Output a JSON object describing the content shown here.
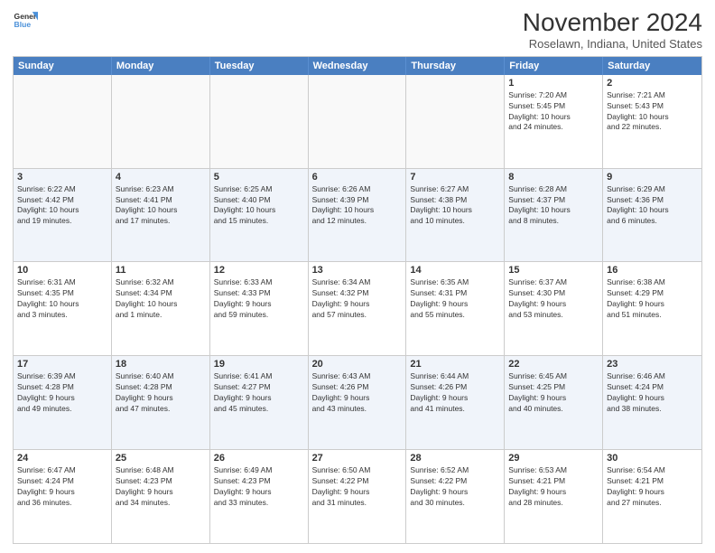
{
  "logo": {
    "line1": "General",
    "line2": "Blue"
  },
  "title": "November 2024",
  "subtitle": "Roselawn, Indiana, United States",
  "days_of_week": [
    "Sunday",
    "Monday",
    "Tuesday",
    "Wednesday",
    "Thursday",
    "Friday",
    "Saturday"
  ],
  "weeks": [
    [
      {
        "day": "",
        "info": ""
      },
      {
        "day": "",
        "info": ""
      },
      {
        "day": "",
        "info": ""
      },
      {
        "day": "",
        "info": ""
      },
      {
        "day": "",
        "info": ""
      },
      {
        "day": "1",
        "info": "Sunrise: 7:20 AM\nSunset: 5:45 PM\nDaylight: 10 hours\nand 24 minutes."
      },
      {
        "day": "2",
        "info": "Sunrise: 7:21 AM\nSunset: 5:43 PM\nDaylight: 10 hours\nand 22 minutes."
      }
    ],
    [
      {
        "day": "3",
        "info": "Sunrise: 6:22 AM\nSunset: 4:42 PM\nDaylight: 10 hours\nand 19 minutes."
      },
      {
        "day": "4",
        "info": "Sunrise: 6:23 AM\nSunset: 4:41 PM\nDaylight: 10 hours\nand 17 minutes."
      },
      {
        "day": "5",
        "info": "Sunrise: 6:25 AM\nSunset: 4:40 PM\nDaylight: 10 hours\nand 15 minutes."
      },
      {
        "day": "6",
        "info": "Sunrise: 6:26 AM\nSunset: 4:39 PM\nDaylight: 10 hours\nand 12 minutes."
      },
      {
        "day": "7",
        "info": "Sunrise: 6:27 AM\nSunset: 4:38 PM\nDaylight: 10 hours\nand 10 minutes."
      },
      {
        "day": "8",
        "info": "Sunrise: 6:28 AM\nSunset: 4:37 PM\nDaylight: 10 hours\nand 8 minutes."
      },
      {
        "day": "9",
        "info": "Sunrise: 6:29 AM\nSunset: 4:36 PM\nDaylight: 10 hours\nand 6 minutes."
      }
    ],
    [
      {
        "day": "10",
        "info": "Sunrise: 6:31 AM\nSunset: 4:35 PM\nDaylight: 10 hours\nand 3 minutes."
      },
      {
        "day": "11",
        "info": "Sunrise: 6:32 AM\nSunset: 4:34 PM\nDaylight: 10 hours\nand 1 minute."
      },
      {
        "day": "12",
        "info": "Sunrise: 6:33 AM\nSunset: 4:33 PM\nDaylight: 9 hours\nand 59 minutes."
      },
      {
        "day": "13",
        "info": "Sunrise: 6:34 AM\nSunset: 4:32 PM\nDaylight: 9 hours\nand 57 minutes."
      },
      {
        "day": "14",
        "info": "Sunrise: 6:35 AM\nSunset: 4:31 PM\nDaylight: 9 hours\nand 55 minutes."
      },
      {
        "day": "15",
        "info": "Sunrise: 6:37 AM\nSunset: 4:30 PM\nDaylight: 9 hours\nand 53 minutes."
      },
      {
        "day": "16",
        "info": "Sunrise: 6:38 AM\nSunset: 4:29 PM\nDaylight: 9 hours\nand 51 minutes."
      }
    ],
    [
      {
        "day": "17",
        "info": "Sunrise: 6:39 AM\nSunset: 4:28 PM\nDaylight: 9 hours\nand 49 minutes."
      },
      {
        "day": "18",
        "info": "Sunrise: 6:40 AM\nSunset: 4:28 PM\nDaylight: 9 hours\nand 47 minutes."
      },
      {
        "day": "19",
        "info": "Sunrise: 6:41 AM\nSunset: 4:27 PM\nDaylight: 9 hours\nand 45 minutes."
      },
      {
        "day": "20",
        "info": "Sunrise: 6:43 AM\nSunset: 4:26 PM\nDaylight: 9 hours\nand 43 minutes."
      },
      {
        "day": "21",
        "info": "Sunrise: 6:44 AM\nSunset: 4:26 PM\nDaylight: 9 hours\nand 41 minutes."
      },
      {
        "day": "22",
        "info": "Sunrise: 6:45 AM\nSunset: 4:25 PM\nDaylight: 9 hours\nand 40 minutes."
      },
      {
        "day": "23",
        "info": "Sunrise: 6:46 AM\nSunset: 4:24 PM\nDaylight: 9 hours\nand 38 minutes."
      }
    ],
    [
      {
        "day": "24",
        "info": "Sunrise: 6:47 AM\nSunset: 4:24 PM\nDaylight: 9 hours\nand 36 minutes."
      },
      {
        "day": "25",
        "info": "Sunrise: 6:48 AM\nSunset: 4:23 PM\nDaylight: 9 hours\nand 34 minutes."
      },
      {
        "day": "26",
        "info": "Sunrise: 6:49 AM\nSunset: 4:23 PM\nDaylight: 9 hours\nand 33 minutes."
      },
      {
        "day": "27",
        "info": "Sunrise: 6:50 AM\nSunset: 4:22 PM\nDaylight: 9 hours\nand 31 minutes."
      },
      {
        "day": "28",
        "info": "Sunrise: 6:52 AM\nSunset: 4:22 PM\nDaylight: 9 hours\nand 30 minutes."
      },
      {
        "day": "29",
        "info": "Sunrise: 6:53 AM\nSunset: 4:21 PM\nDaylight: 9 hours\nand 28 minutes."
      },
      {
        "day": "30",
        "info": "Sunrise: 6:54 AM\nSunset: 4:21 PM\nDaylight: 9 hours\nand 27 minutes."
      }
    ]
  ],
  "colors": {
    "header_bg": "#4a7fc1",
    "alt_row_bg": "#eef2fa",
    "empty_bg": "#f9f9f9",
    "cell_bg": "#ffffff",
    "border": "#cccccc"
  }
}
